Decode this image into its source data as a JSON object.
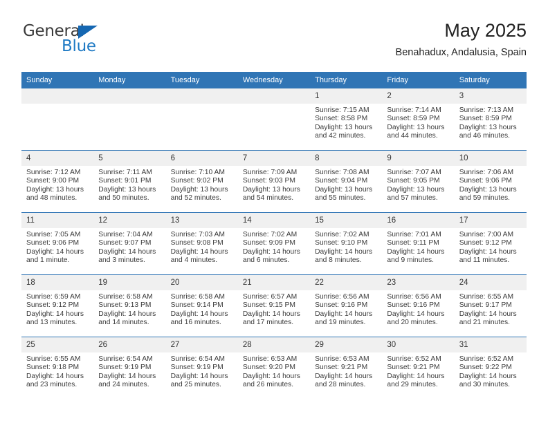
{
  "brand": {
    "name_part1": "General",
    "name_part2": "Blue",
    "triangle_icon": "blue-triangle-icon",
    "colors": {
      "general_text": "#3b3b3b",
      "blue_text": "#1f7ac4",
      "triangle": "#1567b2"
    }
  },
  "header": {
    "title": "May 2025",
    "subtitle": "Benahadux, Andalusia, Spain"
  },
  "theme": {
    "header_blue": "#3075b5",
    "daynum_band": "#f0f0f0",
    "row_divider": "#3075b5",
    "page_background": "#ffffff"
  },
  "calendar": {
    "weekday_headers": [
      "Sunday",
      "Monday",
      "Tuesday",
      "Wednesday",
      "Thursday",
      "Friday",
      "Saturday"
    ],
    "weeks": [
      [
        {
          "day": "",
          "empty": true,
          "sunrise": "",
          "sunset": "",
          "daylight1": "",
          "daylight2": ""
        },
        {
          "day": "",
          "empty": true,
          "sunrise": "",
          "sunset": "",
          "daylight1": "",
          "daylight2": ""
        },
        {
          "day": "",
          "empty": true,
          "sunrise": "",
          "sunset": "",
          "daylight1": "",
          "daylight2": ""
        },
        {
          "day": "",
          "empty": true,
          "sunrise": "",
          "sunset": "",
          "daylight1": "",
          "daylight2": ""
        },
        {
          "day": "1",
          "empty": false,
          "sunrise": "Sunrise: 7:15 AM",
          "sunset": "Sunset: 8:58 PM",
          "daylight1": "Daylight: 13 hours",
          "daylight2": "and 42 minutes."
        },
        {
          "day": "2",
          "empty": false,
          "sunrise": "Sunrise: 7:14 AM",
          "sunset": "Sunset: 8:59 PM",
          "daylight1": "Daylight: 13 hours",
          "daylight2": "and 44 minutes."
        },
        {
          "day": "3",
          "empty": false,
          "sunrise": "Sunrise: 7:13 AM",
          "sunset": "Sunset: 8:59 PM",
          "daylight1": "Daylight: 13 hours",
          "daylight2": "and 46 minutes."
        }
      ],
      [
        {
          "day": "4",
          "empty": false,
          "sunrise": "Sunrise: 7:12 AM",
          "sunset": "Sunset: 9:00 PM",
          "daylight1": "Daylight: 13 hours",
          "daylight2": "and 48 minutes."
        },
        {
          "day": "5",
          "empty": false,
          "sunrise": "Sunrise: 7:11 AM",
          "sunset": "Sunset: 9:01 PM",
          "daylight1": "Daylight: 13 hours",
          "daylight2": "and 50 minutes."
        },
        {
          "day": "6",
          "empty": false,
          "sunrise": "Sunrise: 7:10 AM",
          "sunset": "Sunset: 9:02 PM",
          "daylight1": "Daylight: 13 hours",
          "daylight2": "and 52 minutes."
        },
        {
          "day": "7",
          "empty": false,
          "sunrise": "Sunrise: 7:09 AM",
          "sunset": "Sunset: 9:03 PM",
          "daylight1": "Daylight: 13 hours",
          "daylight2": "and 54 minutes."
        },
        {
          "day": "8",
          "empty": false,
          "sunrise": "Sunrise: 7:08 AM",
          "sunset": "Sunset: 9:04 PM",
          "daylight1": "Daylight: 13 hours",
          "daylight2": "and 55 minutes."
        },
        {
          "day": "9",
          "empty": false,
          "sunrise": "Sunrise: 7:07 AM",
          "sunset": "Sunset: 9:05 PM",
          "daylight1": "Daylight: 13 hours",
          "daylight2": "and 57 minutes."
        },
        {
          "day": "10",
          "empty": false,
          "sunrise": "Sunrise: 7:06 AM",
          "sunset": "Sunset: 9:06 PM",
          "daylight1": "Daylight: 13 hours",
          "daylight2": "and 59 minutes."
        }
      ],
      [
        {
          "day": "11",
          "empty": false,
          "sunrise": "Sunrise: 7:05 AM",
          "sunset": "Sunset: 9:06 PM",
          "daylight1": "Daylight: 14 hours",
          "daylight2": "and 1 minute."
        },
        {
          "day": "12",
          "empty": false,
          "sunrise": "Sunrise: 7:04 AM",
          "sunset": "Sunset: 9:07 PM",
          "daylight1": "Daylight: 14 hours",
          "daylight2": "and 3 minutes."
        },
        {
          "day": "13",
          "empty": false,
          "sunrise": "Sunrise: 7:03 AM",
          "sunset": "Sunset: 9:08 PM",
          "daylight1": "Daylight: 14 hours",
          "daylight2": "and 4 minutes."
        },
        {
          "day": "14",
          "empty": false,
          "sunrise": "Sunrise: 7:02 AM",
          "sunset": "Sunset: 9:09 PM",
          "daylight1": "Daylight: 14 hours",
          "daylight2": "and 6 minutes."
        },
        {
          "day": "15",
          "empty": false,
          "sunrise": "Sunrise: 7:02 AM",
          "sunset": "Sunset: 9:10 PM",
          "daylight1": "Daylight: 14 hours",
          "daylight2": "and 8 minutes."
        },
        {
          "day": "16",
          "empty": false,
          "sunrise": "Sunrise: 7:01 AM",
          "sunset": "Sunset: 9:11 PM",
          "daylight1": "Daylight: 14 hours",
          "daylight2": "and 9 minutes."
        },
        {
          "day": "17",
          "empty": false,
          "sunrise": "Sunrise: 7:00 AM",
          "sunset": "Sunset: 9:12 PM",
          "daylight1": "Daylight: 14 hours",
          "daylight2": "and 11 minutes."
        }
      ],
      [
        {
          "day": "18",
          "empty": false,
          "sunrise": "Sunrise: 6:59 AM",
          "sunset": "Sunset: 9:12 PM",
          "daylight1": "Daylight: 14 hours",
          "daylight2": "and 13 minutes."
        },
        {
          "day": "19",
          "empty": false,
          "sunrise": "Sunrise: 6:58 AM",
          "sunset": "Sunset: 9:13 PM",
          "daylight1": "Daylight: 14 hours",
          "daylight2": "and 14 minutes."
        },
        {
          "day": "20",
          "empty": false,
          "sunrise": "Sunrise: 6:58 AM",
          "sunset": "Sunset: 9:14 PM",
          "daylight1": "Daylight: 14 hours",
          "daylight2": "and 16 minutes."
        },
        {
          "day": "21",
          "empty": false,
          "sunrise": "Sunrise: 6:57 AM",
          "sunset": "Sunset: 9:15 PM",
          "daylight1": "Daylight: 14 hours",
          "daylight2": "and 17 minutes."
        },
        {
          "day": "22",
          "empty": false,
          "sunrise": "Sunrise: 6:56 AM",
          "sunset": "Sunset: 9:16 PM",
          "daylight1": "Daylight: 14 hours",
          "daylight2": "and 19 minutes."
        },
        {
          "day": "23",
          "empty": false,
          "sunrise": "Sunrise: 6:56 AM",
          "sunset": "Sunset: 9:16 PM",
          "daylight1": "Daylight: 14 hours",
          "daylight2": "and 20 minutes."
        },
        {
          "day": "24",
          "empty": false,
          "sunrise": "Sunrise: 6:55 AM",
          "sunset": "Sunset: 9:17 PM",
          "daylight1": "Daylight: 14 hours",
          "daylight2": "and 21 minutes."
        }
      ],
      [
        {
          "day": "25",
          "empty": false,
          "sunrise": "Sunrise: 6:55 AM",
          "sunset": "Sunset: 9:18 PM",
          "daylight1": "Daylight: 14 hours",
          "daylight2": "and 23 minutes."
        },
        {
          "day": "26",
          "empty": false,
          "sunrise": "Sunrise: 6:54 AM",
          "sunset": "Sunset: 9:19 PM",
          "daylight1": "Daylight: 14 hours",
          "daylight2": "and 24 minutes."
        },
        {
          "day": "27",
          "empty": false,
          "sunrise": "Sunrise: 6:54 AM",
          "sunset": "Sunset: 9:19 PM",
          "daylight1": "Daylight: 14 hours",
          "daylight2": "and 25 minutes."
        },
        {
          "day": "28",
          "empty": false,
          "sunrise": "Sunrise: 6:53 AM",
          "sunset": "Sunset: 9:20 PM",
          "daylight1": "Daylight: 14 hours",
          "daylight2": "and 26 minutes."
        },
        {
          "day": "29",
          "empty": false,
          "sunrise": "Sunrise: 6:53 AM",
          "sunset": "Sunset: 9:21 PM",
          "daylight1": "Daylight: 14 hours",
          "daylight2": "and 28 minutes."
        },
        {
          "day": "30",
          "empty": false,
          "sunrise": "Sunrise: 6:52 AM",
          "sunset": "Sunset: 9:21 PM",
          "daylight1": "Daylight: 14 hours",
          "daylight2": "and 29 minutes."
        },
        {
          "day": "31",
          "empty": false,
          "sunrise": "Sunrise: 6:52 AM",
          "sunset": "Sunset: 9:22 PM",
          "daylight1": "Daylight: 14 hours",
          "daylight2": "and 30 minutes."
        }
      ]
    ]
  }
}
